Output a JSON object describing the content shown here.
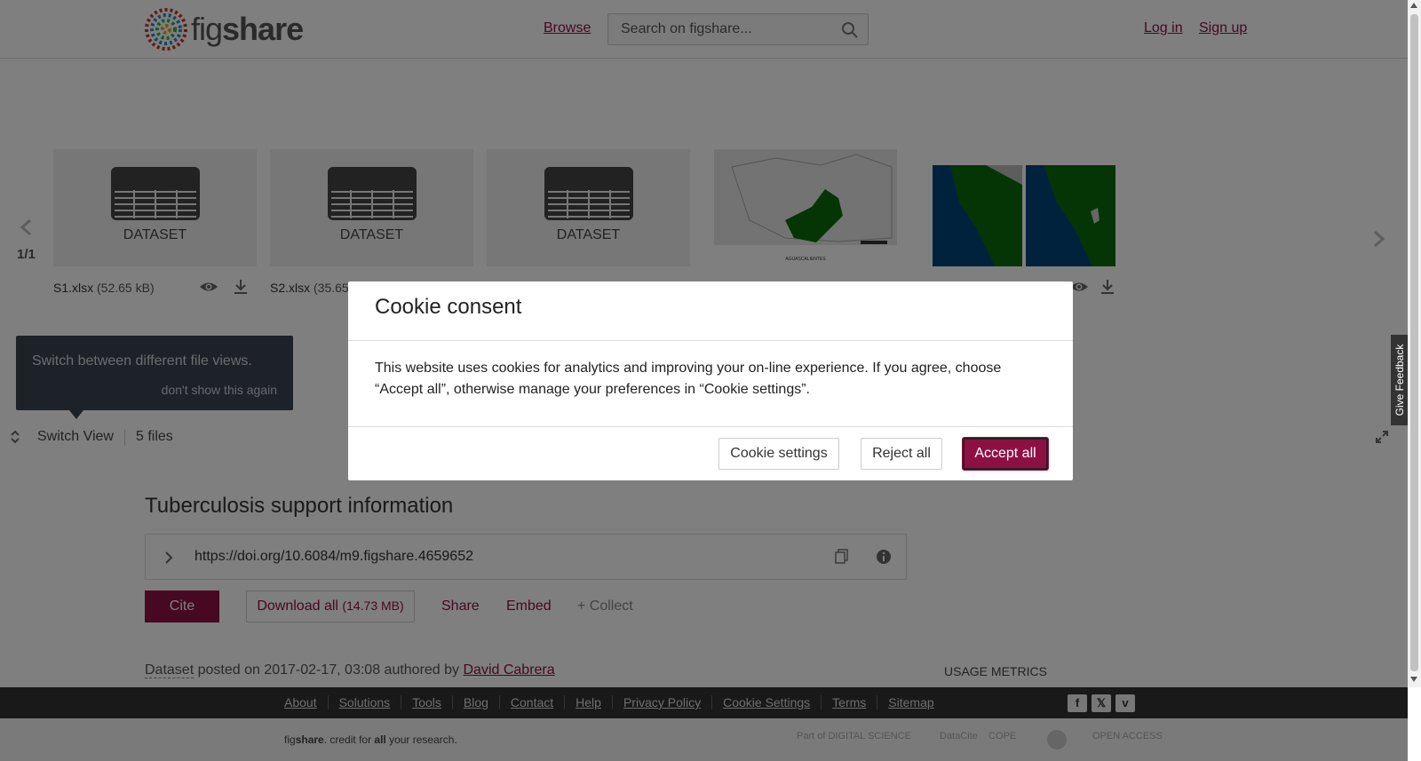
{
  "header": {
    "logo_fig": "fig",
    "logo_share": "share",
    "browse": "Browse",
    "search_placeholder": "Search on figshare...",
    "login": "Log in",
    "signup": "Sign up"
  },
  "carousel": {
    "page_indicator": "1/1",
    "files": [
      {
        "name": "S1.xlsx",
        "size": "(52.65 kB)",
        "type_label": "DATASET"
      },
      {
        "name": "S2.xlsx",
        "size": "(35.65",
        "type_label": "DATASET"
      },
      {
        "name": "",
        "size": "",
        "type_label": "DATASET"
      },
      {
        "name": "",
        "size": "",
        "type_label": ""
      },
      {
        "name": "",
        "size": "",
        "type_label": ""
      }
    ],
    "map_caption": "AGUASCALIENTES",
    "tooltip_text": "Switch between different file views.",
    "tooltip_dismiss": "don't show this again",
    "switch_view": "Switch View",
    "files_count": "5 files"
  },
  "main": {
    "title": "Tuberculosis support information",
    "doi": "https://doi.org/10.6084/m9.figshare.4659652",
    "cite": "Cite",
    "download_all": "Download all",
    "download_size": "(14.73 MB)",
    "share": "Share",
    "embed": "Embed",
    "collect": "+ Collect",
    "item_type": "Dataset",
    "posted_text": "posted on 2017-02-17, 03:08 authored by",
    "author": "David Cabrera",
    "usage_metrics": "USAGE METRICS"
  },
  "footer": {
    "links": [
      "About",
      "Solutions",
      "Tools",
      "Blog",
      "Contact",
      "Help",
      "Privacy Policy",
      "Cookie Settings",
      "Terms",
      "Sitemap"
    ],
    "social": [
      {
        "icon": "facebook-icon",
        "glyph": "f"
      },
      {
        "icon": "x-twitter-icon",
        "glyph": "𝕏"
      },
      {
        "icon": "vimeo-icon",
        "glyph": "v"
      }
    ],
    "tagline_fig": "fig",
    "tagline_share": "share",
    "tagline_mid": ". credit for ",
    "tagline_all": "all",
    "tagline_end": " your research.",
    "partner_digital_science": "Part of DIGITAL SCIENCE",
    "partner_datacite": "DataCite",
    "partner_cope": "COPE",
    "partner_open_access": "OPEN ACCESS"
  },
  "cookie_modal": {
    "title": "Cookie consent",
    "body": "This website uses cookies for analytics and improving your on-line experience. If you agree, choose “Accept all”, otherwise manage your preferences in “Cookie settings”.",
    "settings": "Cookie settings",
    "reject": "Reject all",
    "accept": "Accept all"
  },
  "feedback": "Give Feedback",
  "colors": {
    "brand": "#8e1043",
    "map_region": "#0b6b0b",
    "map_water": "#02457a"
  }
}
